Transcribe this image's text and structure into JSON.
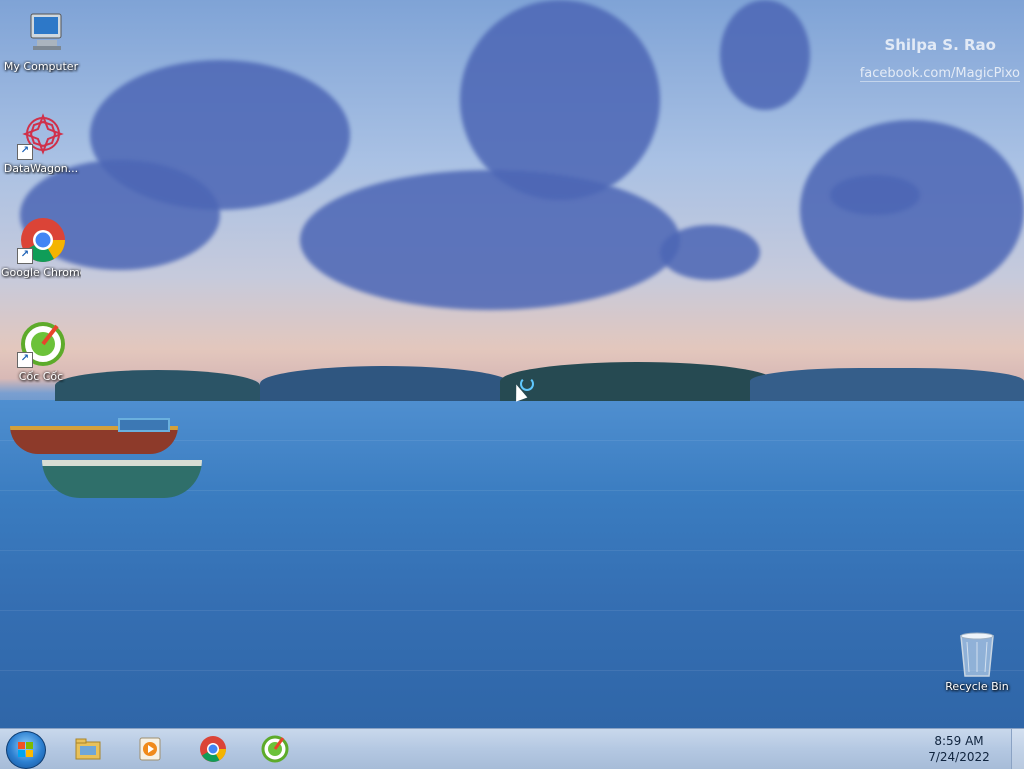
{
  "watermark": {
    "name": "Shilpa S. Rao",
    "link": "facebook.com/MagicPixo"
  },
  "desktop": {
    "icons": [
      {
        "label": "My Computer",
        "icon": "computer-icon"
      },
      {
        "label": "DataWagon...",
        "icon": "datawagon-icon",
        "shortcut": true
      },
      {
        "label": "Google Chrome",
        "icon": "chrome-icon",
        "shortcut": true
      },
      {
        "label": "Cốc Cốc",
        "icon": "coccoc-icon",
        "shortcut": true
      },
      {
        "label": "Recycle Bin",
        "icon": "recycle-bin-icon"
      }
    ]
  },
  "taskbar": {
    "start": "start-button",
    "pinned": [
      "file-explorer-icon",
      "media-player-icon",
      "chrome-icon",
      "coccoc-icon"
    ],
    "clock": {
      "time": "8:59 AM",
      "date": "7/24/2022"
    }
  },
  "colors": {
    "taskbar": "#b4c8e2",
    "sea": "#3472b6",
    "sky_top": "#7fa3d6"
  }
}
